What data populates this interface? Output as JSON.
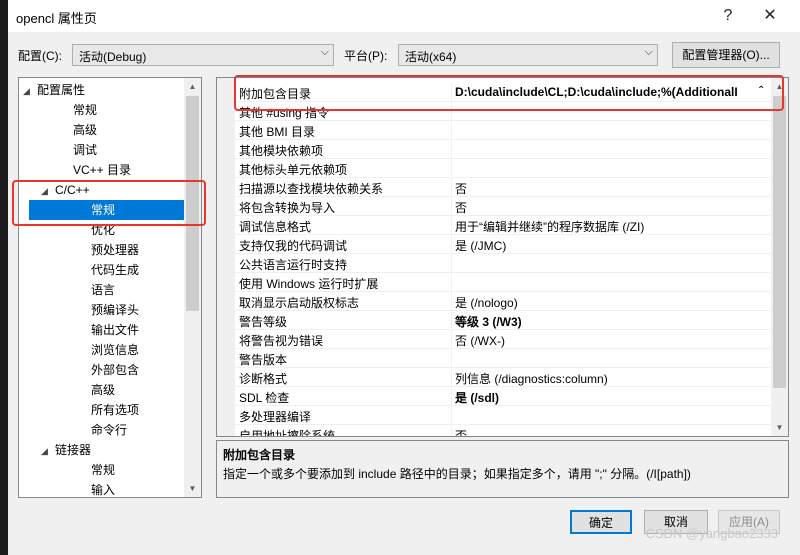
{
  "window": {
    "title": "opencl 属性页",
    "help": "?",
    "close": "✕"
  },
  "config": {
    "config_label": "配置(C):",
    "config_value": "活动(Debug)",
    "platform_label": "平台(P):",
    "platform_value": "活动(x64)",
    "manager_button": "配置管理器(O)..."
  },
  "tree": [
    {
      "label": "配置属性",
      "expander": "◢"
    },
    {
      "label": "常规",
      "expander": ""
    },
    {
      "label": "高级",
      "expander": ""
    },
    {
      "label": "调试",
      "expander": ""
    },
    {
      "label": "VC++ 目录",
      "expander": ""
    },
    {
      "label": "C/C++",
      "expander": "◢"
    },
    {
      "label": "常规",
      "expander": ""
    },
    {
      "label": "优化",
      "expander": ""
    },
    {
      "label": "预处理器",
      "expander": ""
    },
    {
      "label": "代码生成",
      "expander": ""
    },
    {
      "label": "语言",
      "expander": ""
    },
    {
      "label": "预编译头",
      "expander": ""
    },
    {
      "label": "输出文件",
      "expander": ""
    },
    {
      "label": "浏览信息",
      "expander": ""
    },
    {
      "label": "外部包含",
      "expander": ""
    },
    {
      "label": "高级",
      "expander": ""
    },
    {
      "label": "所有选项",
      "expander": ""
    },
    {
      "label": "命令行",
      "expander": ""
    },
    {
      "label": "链接器",
      "expander": "◢"
    },
    {
      "label": "常规",
      "expander": ""
    },
    {
      "label": "输入",
      "expander": ""
    }
  ],
  "grid": [
    {
      "name": "附加包含目录",
      "value": "D:\\cuda\\include\\CL;D:\\cuda\\include;%(AdditionalI"
    },
    {
      "name": "其他 #using 指令",
      "value": ""
    },
    {
      "name": "其他 BMI 目录",
      "value": ""
    },
    {
      "name": "其他模块依赖项",
      "value": ""
    },
    {
      "name": "其他标头单元依赖项",
      "value": ""
    },
    {
      "name": "扫描源以查找模块依赖关系",
      "value": "否"
    },
    {
      "name": "将包含转换为导入",
      "value": "否"
    },
    {
      "name": "调试信息格式",
      "value": "用于“编辑并继续”的程序数据库 (/ZI)"
    },
    {
      "name": "支持仅我的代码调试",
      "value": "是 (/JMC)"
    },
    {
      "name": "公共语言运行时支持",
      "value": ""
    },
    {
      "name": "使用 Windows 运行时扩展",
      "value": ""
    },
    {
      "name": "取消显示启动版权标志",
      "value": "是 (/nologo)"
    },
    {
      "name": "警告等级",
      "value": "等级 3 (/W3)"
    },
    {
      "name": "将警告视为错误",
      "value": "否 (/WX-)"
    },
    {
      "name": "警告版本",
      "value": ""
    },
    {
      "name": "诊断格式",
      "value": "列信息 (/diagnostics:column)"
    },
    {
      "name": "SDL 检查",
      "value": "是 (/sdl)"
    },
    {
      "name": "多处理器编译",
      "value": ""
    },
    {
      "name": "启用地址擦除系统",
      "value": "否"
    }
  ],
  "description": {
    "title": "附加包含目录",
    "text": "指定一个或多个要添加到 include 路径中的目录；如果指定多个，请用 \";\" 分隔。(/I[path])"
  },
  "buttons": {
    "ok": "确定",
    "cancel": "取消",
    "apply": "应用(A)"
  },
  "watermark": "CSDN @yangbao2333",
  "colors": {
    "selection": "#0078d7",
    "highlight_box": "#e8352d"
  }
}
